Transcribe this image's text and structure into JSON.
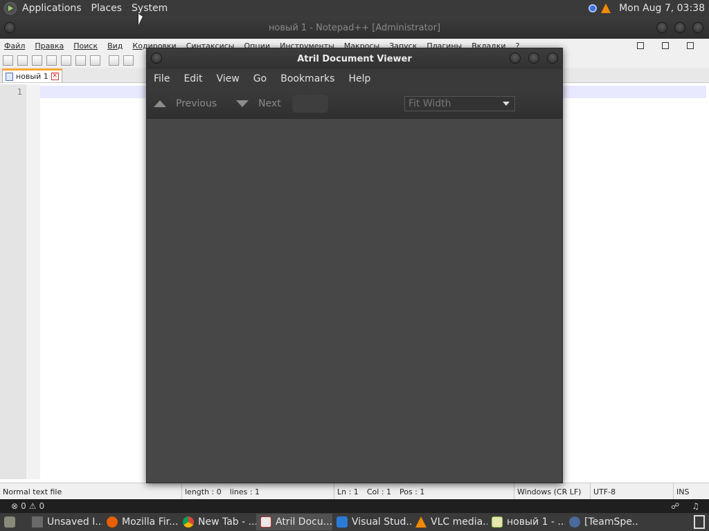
{
  "top_panel": {
    "menus": [
      "Applications",
      "Places",
      "System"
    ],
    "clock": "Mon Aug  7, 03:38"
  },
  "notepad": {
    "title": "новый 1 - Notepad++ [Administrator]",
    "menu": [
      "Файл",
      "Правка",
      "Поиск",
      "Вид",
      "Кодировки",
      "Синтаксисы",
      "Опции",
      "Инструменты",
      "Макросы",
      "Запуск",
      "Плагины",
      "Вкладки",
      "?"
    ],
    "tab_label": "новый 1",
    "line_number": "1",
    "status": {
      "file_type": "Normal text file",
      "length": "length : 0",
      "lines": "lines : 1",
      "ln": "Ln : 1",
      "col": "Col : 1",
      "pos": "Pos : 1",
      "eol": "Windows (CR LF)",
      "encoding": "UTF-8",
      "mode": "INS"
    }
  },
  "atril": {
    "title": "Atril Document Viewer",
    "menu": [
      "File",
      "Edit",
      "View",
      "Go",
      "Bookmarks",
      "Help"
    ],
    "previous_label": "Previous",
    "next_label": "Next",
    "zoom_value": "Fit Width"
  },
  "vscode_status": {
    "errors": "0",
    "warnings": "0"
  },
  "taskbar": [
    {
      "label": "Unsaved I...",
      "icon": "folder-icon",
      "color": "#8a8a7a"
    },
    {
      "label": "Mozilla Fir...",
      "icon": "firefox-icon",
      "color": "#e66000"
    },
    {
      "label": "New Tab - ...",
      "icon": "chrome-icon",
      "color": "#4285f4"
    },
    {
      "label": "Atril Docu...",
      "icon": "atril-icon",
      "color": "#c0392b",
      "active": true
    },
    {
      "label": "Visual Stud...",
      "icon": "vscode-icon",
      "color": "#2b7bd6"
    },
    {
      "label": "VLC media...",
      "icon": "vlc-icon",
      "color": "#f08a00"
    },
    {
      "label": "новый 1 - ...",
      "icon": "notepadpp-icon",
      "color": "#8bc34a"
    },
    {
      "label": "[TeamSpe...",
      "icon": "teamspeak-icon",
      "color": "#4a6a9a"
    }
  ],
  "colors": {
    "panel_bg": "#3a3a3a",
    "atril_bg": "#474747",
    "tab_accent": "#f8a833"
  }
}
